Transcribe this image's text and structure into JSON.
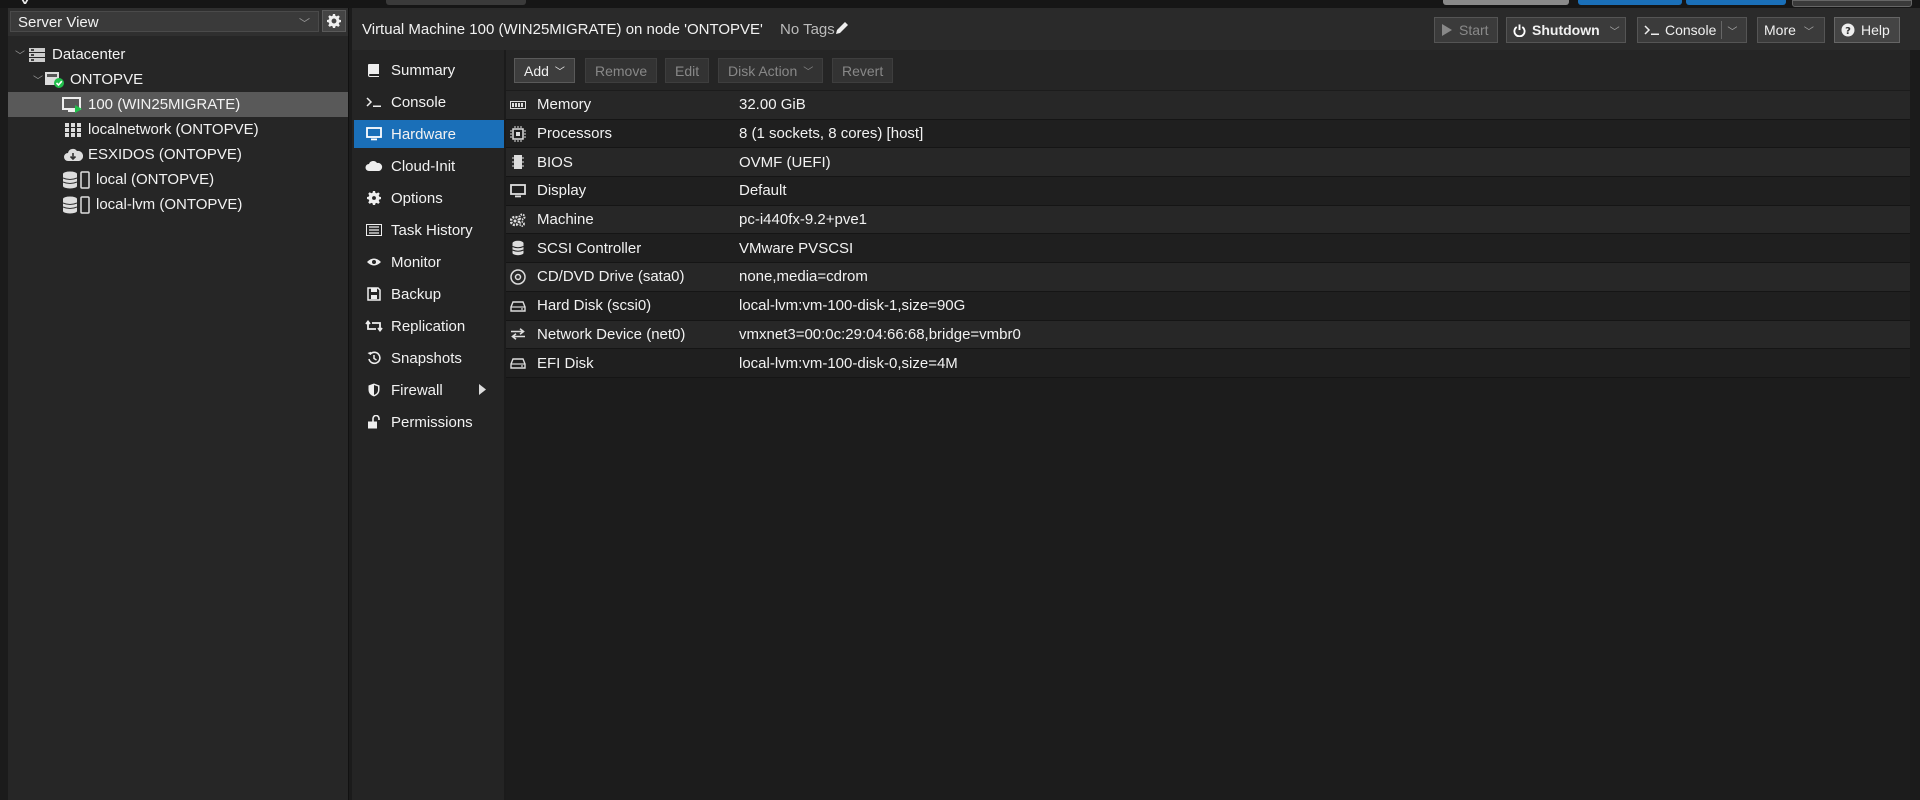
{
  "left_panel": {
    "view_select": "Server View",
    "tree": [
      {
        "label": "Datacenter",
        "icon": "datacenter-icon",
        "level": 0
      },
      {
        "label": "ONTOPVE",
        "icon": "node-online-icon",
        "level": 1
      },
      {
        "label": "100 (WIN25MIGRATE)",
        "icon": "vm-running-icon",
        "level": 2,
        "selected": true
      },
      {
        "label": "localnetwork (ONTOPVE)",
        "icon": "sdn-grid-icon",
        "level": 2
      },
      {
        "label": "ESXIDOS (ONTOPVE)",
        "icon": "cloud-storage-icon",
        "level": 2
      },
      {
        "label": "local (ONTOPVE)",
        "icon": "storage-icon",
        "level": 2
      },
      {
        "label": "local-lvm (ONTOPVE)",
        "icon": "storage-icon",
        "level": 2
      }
    ]
  },
  "header": {
    "title": "Virtual Machine 100 (WIN25MIGRATE) on node 'ONTOPVE'",
    "tags": "No Tags",
    "buttons": {
      "start": "Start",
      "shutdown": "Shutdown",
      "console": "Console",
      "more": "More",
      "help": "Help"
    }
  },
  "nav": [
    {
      "label": "Summary",
      "icon": "book-icon"
    },
    {
      "label": "Console",
      "icon": "terminal-icon"
    },
    {
      "label": "Hardware",
      "icon": "monitor-icon",
      "active": true
    },
    {
      "label": "Cloud-Init",
      "icon": "cloud-icon"
    },
    {
      "label": "Options",
      "icon": "gear-icon"
    },
    {
      "label": "Task History",
      "icon": "list-icon"
    },
    {
      "label": "Monitor",
      "icon": "eye-icon"
    },
    {
      "label": "Backup",
      "icon": "floppy-icon"
    },
    {
      "label": "Replication",
      "icon": "retweet-icon"
    },
    {
      "label": "Snapshots",
      "icon": "history-icon"
    },
    {
      "label": "Firewall",
      "icon": "shield-icon"
    },
    {
      "label": "Permissions",
      "icon": "unlock-icon"
    }
  ],
  "toolbar": {
    "add": "Add",
    "remove": "Remove",
    "edit": "Edit",
    "disk_action": "Disk Action",
    "revert": "Revert"
  },
  "hardware": [
    {
      "name": "Memory",
      "value": "32.00 GiB",
      "icon": "memory-icon"
    },
    {
      "name": "Processors",
      "value": "8 (1 sockets, 8 cores) [host]",
      "icon": "cpu-icon"
    },
    {
      "name": "BIOS",
      "value": "OVMF (UEFI)",
      "icon": "microchip-icon"
    },
    {
      "name": "Display",
      "value": "Default",
      "icon": "desktop-icon"
    },
    {
      "name": "Machine",
      "value": "pc-i440fx-9.2+pve1",
      "icon": "cogs-icon"
    },
    {
      "name": "SCSI Controller",
      "value": "VMware PVSCSI",
      "icon": "database-icon"
    },
    {
      "name": "CD/DVD Drive (sata0)",
      "value": "none,media=cdrom",
      "icon": "cdrom-icon"
    },
    {
      "name": "Hard Disk (scsi0)",
      "value": "local-lvm:vm-100-disk-1,size=90G",
      "icon": "hdd-icon"
    },
    {
      "name": "Network Device (net0)",
      "value": "vmxnet3=00:0c:29:04:66:68,bridge=vmbr0",
      "icon": "exchange-icon"
    },
    {
      "name": "EFI Disk",
      "value": "local-lvm:vm-100-disk-0,size=4M",
      "icon": "hdd-icon"
    }
  ],
  "colors": {
    "accent": "#1a6fb8",
    "selected_tree": "#595959",
    "status_online": "#21bf4b"
  }
}
